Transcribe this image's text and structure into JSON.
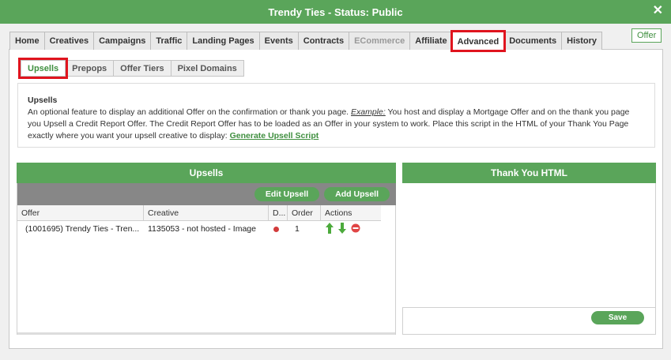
{
  "window": {
    "title": "Trendy Ties - Status: Public",
    "close_glyph": "✕"
  },
  "offer_badge": "Offer",
  "tabs": [
    {
      "label": "Home"
    },
    {
      "label": "Creatives"
    },
    {
      "label": "Campaigns"
    },
    {
      "label": "Traffic"
    },
    {
      "label": "Landing Pages"
    },
    {
      "label": "Events"
    },
    {
      "label": "Contracts"
    },
    {
      "label": "ECommerce"
    },
    {
      "label": "Affiliate"
    },
    {
      "label": "Advanced"
    },
    {
      "label": "Documents"
    },
    {
      "label": "History"
    }
  ],
  "subtabs": [
    {
      "label": "Upsells"
    },
    {
      "label": "Prepops"
    },
    {
      "label": "Offer Tiers"
    },
    {
      "label": "Pixel Domains"
    }
  ],
  "info": {
    "heading": "Upsells",
    "text_part1": "An optional feature to display an additional Offer on the confirmation or thank you page. ",
    "example_label": "Example:",
    "text_part2": " You host and display a Mortgage Offer and on the thank you page you Upsell a Credit Report Offer. The Credit Report Offer has to be loaded as an Offer in your system to work. Place this script in the HTML of your Thank You Page exactly where you want your upsell creative to display: ",
    "link_label": "Generate Upsell Script"
  },
  "upsells": {
    "title": "Upsells",
    "edit_button": "Edit Upsell",
    "add_button": "Add Upsell",
    "columns": [
      "Offer",
      "Creative",
      "D...",
      "Order",
      "Actions"
    ],
    "rows": [
      {
        "offer": "(1001695) Trendy Ties - Tren...",
        "creative": "1135053 - not hosted - Image",
        "order": "1"
      }
    ]
  },
  "thank_you": {
    "title": "Thank You HTML",
    "save_button": "Save"
  },
  "colors": {
    "brand_green": "#5aa55a",
    "highlight_red": "#e0141e",
    "toolbar_gray": "#878787"
  }
}
